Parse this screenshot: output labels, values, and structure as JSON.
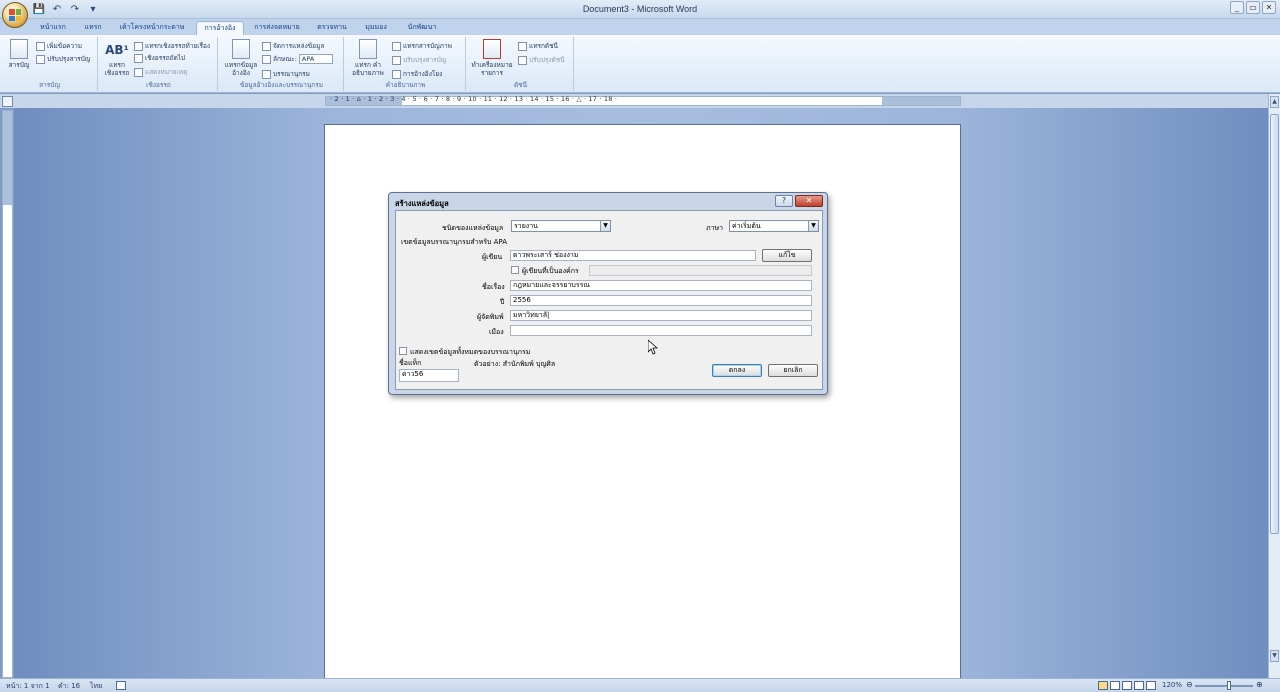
{
  "window": {
    "title": "Document3 - Microsoft Word",
    "controls": [
      "_",
      "▭",
      "✕"
    ]
  },
  "qat": {
    "save": "💾",
    "undo": "↶",
    "redo": "↷",
    "more": "▾"
  },
  "tabs": [
    {
      "label": "หน้าแรก"
    },
    {
      "label": "แทรก"
    },
    {
      "label": "เค้าโครงหน้ากระดาษ"
    },
    {
      "label": "การอ้างอิง"
    },
    {
      "label": "การส่งจดหมาย"
    },
    {
      "label": "ตรวจทาน"
    },
    {
      "label": "มุมมอง"
    },
    {
      "label": "นักพัฒนา"
    }
  ],
  "ribbon": {
    "toc": {
      "big": "สารบัญ",
      "add_text": "เพิ่มข้อความ",
      "update": "ปรับปรุงสารบัญ",
      "group": "สารบัญ"
    },
    "footnotes": {
      "big_icon": "AB¹",
      "big": "แทรก เชิงอรรถ",
      "insert_endnote": "แทรกเชิงอรรถท้ายเรื่อง",
      "next": "เชิงอรรถถัดไป",
      "show": "แสดงหมายเหตุ",
      "group": "เชิงอรรถ"
    },
    "citations": {
      "big": "แทรกข้อมูล อ้างอิง",
      "manage": "จัดการแหล่งข้อมูล",
      "style_label": "ลักษณะ:",
      "style_value": "APA",
      "bibliography": "บรรณานุกรม",
      "group": "ข้อมูลอ้างอิงและบรรณานุกรม"
    },
    "captions": {
      "big": "แทรก คำอธิบายภาพ",
      "insert_table": "แทรกสารบัญภาพ",
      "update": "ปรับปรุงสารบัญ",
      "cross_ref": "การอ้างอิงโยง",
      "group": "คำอธิบายภาพ"
    },
    "index": {
      "big": "ทำเครื่องหมาย รายการ",
      "insert": "แทรกดัชนี",
      "update": "ปรับปรุงดัชนี",
      "group": "ดัชนี"
    }
  },
  "ruler": {
    "numbers": "· 2 · 1 · ⌂ · 1 · 2 · 3 · 4 · 5 · 6 · 7 · 8 · 9 · 10 · 11 · 12 · 13 · 14 · 15 · 16 · △ · 17 · 18 ·"
  },
  "dialog": {
    "title": "สร้างแหล่งข้อมูล",
    "help": "?",
    "close": "✕",
    "source_type_label": "ชนิดของแหล่งข้อมูล",
    "source_type_value": "รายงาน",
    "language_label": "ภาษา",
    "language_value": "ค่าเริ่มต้น",
    "apa_fields_label": "เขตข้อมูลบรรณานุกรมสำหรับ APA",
    "author_label": "ผู้เขียน",
    "author_value": "ดาวพระเสาร์ ช่องงาม",
    "edit_button": "แก้ไข",
    "corporate_author_label": "ผู้เขียนที่เป็นองค์กร",
    "title_label": "ชื่อเรื่อง",
    "title_value": "กฎหมายและจรรยาบรรณ",
    "year_label": "ปี",
    "year_value": "2556",
    "publisher_label": "ผู้จัดพิมพ์",
    "publisher_value": "มหาวิทยาลั|",
    "city_label": "เมือง",
    "city_value": "",
    "show_all_label": "แสดงเขตข้อมูลทั้งหมดของบรรณานุกรม",
    "tag_label": "ชื่อแท็ก",
    "tag_value": "ดาว56",
    "example_text": "ตัวอย่าง: สำนักพิมพ์ บุญศิล",
    "ok_button": "ตกลง",
    "cancel_button": "ยกเลิก"
  },
  "statusbar": {
    "page": "หน้า: 1 จาก 1",
    "words": "คำ: 16",
    "language": "ไทย",
    "zoom": "120%",
    "zoom_minus": "⊖",
    "zoom_plus": "⊕"
  }
}
